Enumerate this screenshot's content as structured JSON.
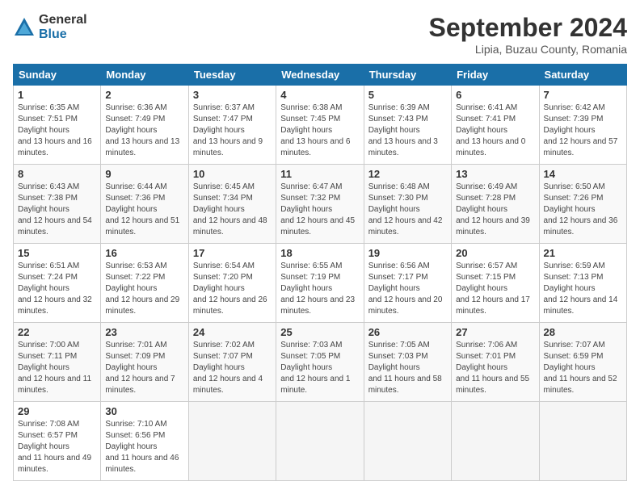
{
  "logo": {
    "general": "General",
    "blue": "Blue"
  },
  "title": "September 2024",
  "location": "Lipia, Buzau County, Romania",
  "weekdays": [
    "Sunday",
    "Monday",
    "Tuesday",
    "Wednesday",
    "Thursday",
    "Friday",
    "Saturday"
  ],
  "weeks": [
    [
      {
        "day": "1",
        "sunrise": "6:35 AM",
        "sunset": "7:51 PM",
        "daylight": "13 hours and 16 minutes."
      },
      {
        "day": "2",
        "sunrise": "6:36 AM",
        "sunset": "7:49 PM",
        "daylight": "13 hours and 13 minutes."
      },
      {
        "day": "3",
        "sunrise": "6:37 AM",
        "sunset": "7:47 PM",
        "daylight": "13 hours and 9 minutes."
      },
      {
        "day": "4",
        "sunrise": "6:38 AM",
        "sunset": "7:45 PM",
        "daylight": "13 hours and 6 minutes."
      },
      {
        "day": "5",
        "sunrise": "6:39 AM",
        "sunset": "7:43 PM",
        "daylight": "13 hours and 3 minutes."
      },
      {
        "day": "6",
        "sunrise": "6:41 AM",
        "sunset": "7:41 PM",
        "daylight": "13 hours and 0 minutes."
      },
      {
        "day": "7",
        "sunrise": "6:42 AM",
        "sunset": "7:39 PM",
        "daylight": "12 hours and 57 minutes."
      }
    ],
    [
      {
        "day": "8",
        "sunrise": "6:43 AM",
        "sunset": "7:38 PM",
        "daylight": "12 hours and 54 minutes."
      },
      {
        "day": "9",
        "sunrise": "6:44 AM",
        "sunset": "7:36 PM",
        "daylight": "12 hours and 51 minutes."
      },
      {
        "day": "10",
        "sunrise": "6:45 AM",
        "sunset": "7:34 PM",
        "daylight": "12 hours and 48 minutes."
      },
      {
        "day": "11",
        "sunrise": "6:47 AM",
        "sunset": "7:32 PM",
        "daylight": "12 hours and 45 minutes."
      },
      {
        "day": "12",
        "sunrise": "6:48 AM",
        "sunset": "7:30 PM",
        "daylight": "12 hours and 42 minutes."
      },
      {
        "day": "13",
        "sunrise": "6:49 AM",
        "sunset": "7:28 PM",
        "daylight": "12 hours and 39 minutes."
      },
      {
        "day": "14",
        "sunrise": "6:50 AM",
        "sunset": "7:26 PM",
        "daylight": "12 hours and 36 minutes."
      }
    ],
    [
      {
        "day": "15",
        "sunrise": "6:51 AM",
        "sunset": "7:24 PM",
        "daylight": "12 hours and 32 minutes."
      },
      {
        "day": "16",
        "sunrise": "6:53 AM",
        "sunset": "7:22 PM",
        "daylight": "12 hours and 29 minutes."
      },
      {
        "day": "17",
        "sunrise": "6:54 AM",
        "sunset": "7:20 PM",
        "daylight": "12 hours and 26 minutes."
      },
      {
        "day": "18",
        "sunrise": "6:55 AM",
        "sunset": "7:19 PM",
        "daylight": "12 hours and 23 minutes."
      },
      {
        "day": "19",
        "sunrise": "6:56 AM",
        "sunset": "7:17 PM",
        "daylight": "12 hours and 20 minutes."
      },
      {
        "day": "20",
        "sunrise": "6:57 AM",
        "sunset": "7:15 PM",
        "daylight": "12 hours and 17 minutes."
      },
      {
        "day": "21",
        "sunrise": "6:59 AM",
        "sunset": "7:13 PM",
        "daylight": "12 hours and 14 minutes."
      }
    ],
    [
      {
        "day": "22",
        "sunrise": "7:00 AM",
        "sunset": "7:11 PM",
        "daylight": "12 hours and 11 minutes."
      },
      {
        "day": "23",
        "sunrise": "7:01 AM",
        "sunset": "7:09 PM",
        "daylight": "12 hours and 7 minutes."
      },
      {
        "day": "24",
        "sunrise": "7:02 AM",
        "sunset": "7:07 PM",
        "daylight": "12 hours and 4 minutes."
      },
      {
        "day": "25",
        "sunrise": "7:03 AM",
        "sunset": "7:05 PM",
        "daylight": "12 hours and 1 minute."
      },
      {
        "day": "26",
        "sunrise": "7:05 AM",
        "sunset": "7:03 PM",
        "daylight": "11 hours and 58 minutes."
      },
      {
        "day": "27",
        "sunrise": "7:06 AM",
        "sunset": "7:01 PM",
        "daylight": "11 hours and 55 minutes."
      },
      {
        "day": "28",
        "sunrise": "7:07 AM",
        "sunset": "6:59 PM",
        "daylight": "11 hours and 52 minutes."
      }
    ],
    [
      {
        "day": "29",
        "sunrise": "7:08 AM",
        "sunset": "6:57 PM",
        "daylight": "11 hours and 49 minutes."
      },
      {
        "day": "30",
        "sunrise": "7:10 AM",
        "sunset": "6:56 PM",
        "daylight": "11 hours and 46 minutes."
      },
      null,
      null,
      null,
      null,
      null
    ]
  ]
}
